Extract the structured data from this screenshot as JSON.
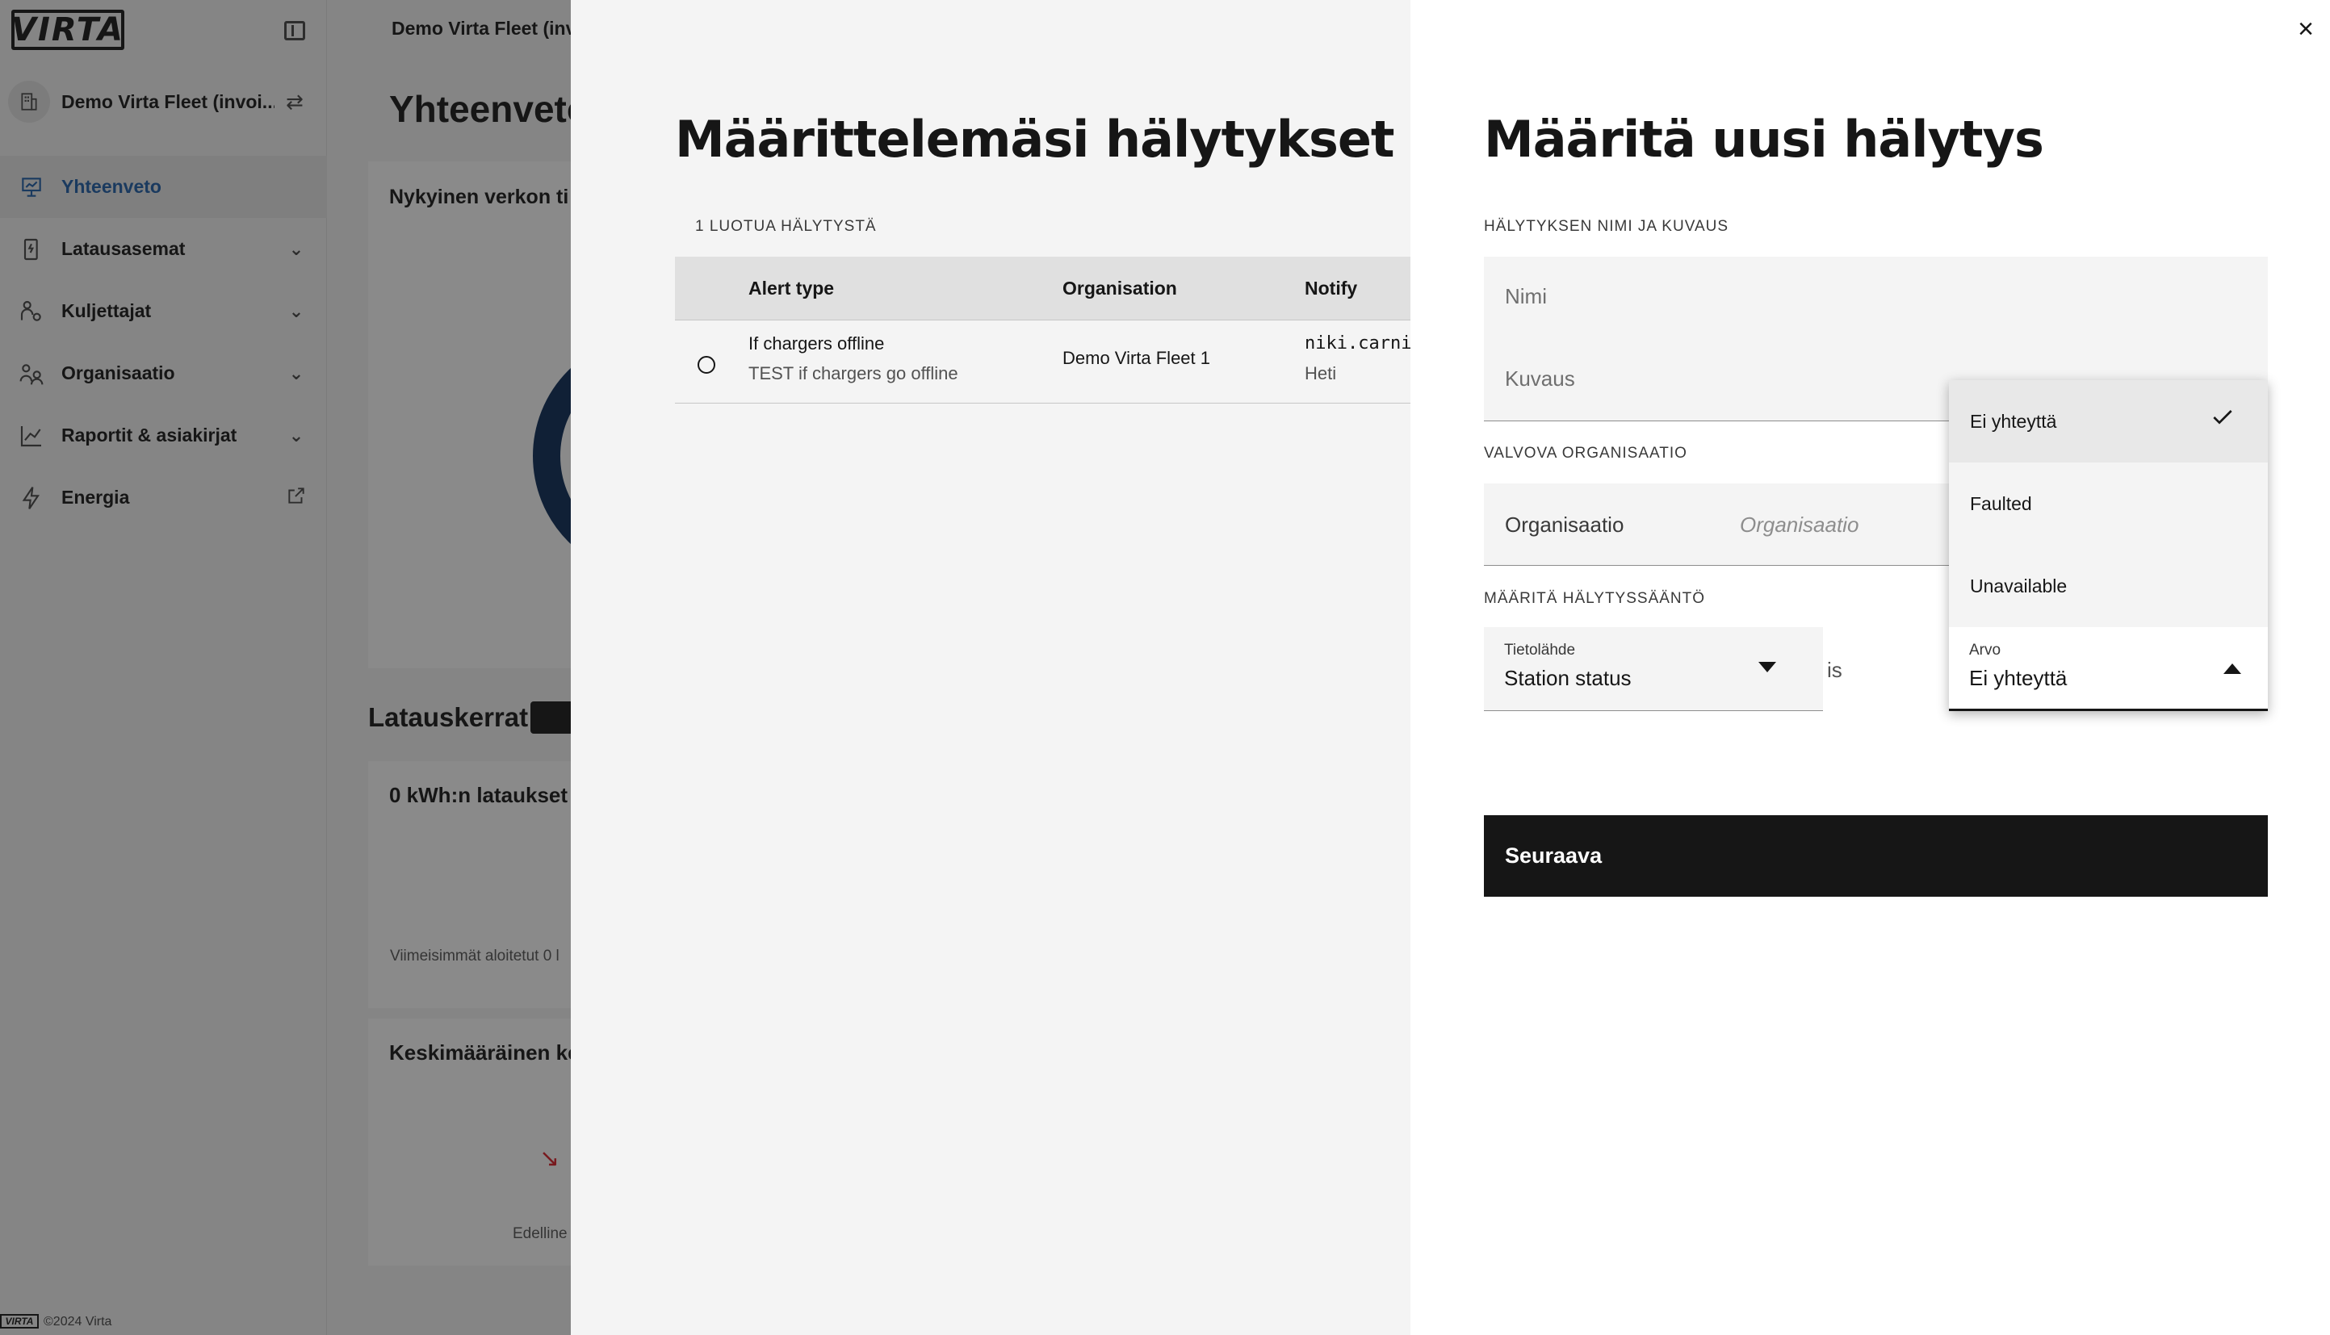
{
  "sidebar": {
    "logo": "VIRTA",
    "org_name": "Demo Virta Fleet (invoi...",
    "items": [
      {
        "label": "Yhteenveto",
        "icon": "dashboard-icon",
        "active": true
      },
      {
        "label": "Latausasemat",
        "icon": "charger-icon",
        "expandable": true
      },
      {
        "label": "Kuljettajat",
        "icon": "drivers-icon",
        "expandable": true
      },
      {
        "label": "Organisaatio",
        "icon": "organisation-icon",
        "expandable": true
      },
      {
        "label": "Raportit & asiakirjat",
        "icon": "reports-icon",
        "expandable": true
      },
      {
        "label": "Energia",
        "icon": "energy-icon",
        "external": true
      }
    ],
    "footer_logo": "VIRTA",
    "footer_text": "©2024 Virta",
    "active_color": "#1f5ea8"
  },
  "background_page": {
    "header": "Demo Virta Fleet (inv",
    "title": "Yhteenveto",
    "network_card_title": "Nykyinen verkon ti",
    "sessions_title": "Latauskerrat",
    "kwh_card_title": "0 kWh:n lataukset",
    "kwh_card_footer": "Viimeisimmät aloitetut 0 l",
    "avg_card_title": "Keskimääräinen ke",
    "avg_card_footer": "Edelline"
  },
  "alerts_panel": {
    "title": "Määrittelemäsi hälytykset",
    "count_label": "1 LUOTUA HÄLYTYSTÄ",
    "columns": [
      "Alert type",
      "Organisation",
      "Notify"
    ],
    "rows": [
      {
        "alert_type": "If chargers offline",
        "description": "TEST if chargers go offline",
        "organisation": "Demo Virta Fleet 1",
        "notify": "niki.carni",
        "notify_timing": "Heti"
      }
    ]
  },
  "form_panel": {
    "title": "Määritä uusi hälytys",
    "section_name": "HÄLYTYKSEN NIMI JA KUVAUS",
    "name_placeholder": "Nimi",
    "description_placeholder": "Kuvaus",
    "section_org": "VALVOVA ORGANISAATIO",
    "org_label": "Organisaatio",
    "org_placeholder": "Organisaatio",
    "section_rule": "MÄÄRITÄ HÄLYTYSSÄÄNTÖ",
    "source_label": "Tietolähde",
    "source_value": "Station status",
    "operator": "is",
    "value_label": "Arvo",
    "value_selected": "Ei yhteyttä",
    "value_options": [
      "Ei yhteyttä",
      "Faulted",
      "Unavailable"
    ],
    "next_button": "Seuraava"
  }
}
